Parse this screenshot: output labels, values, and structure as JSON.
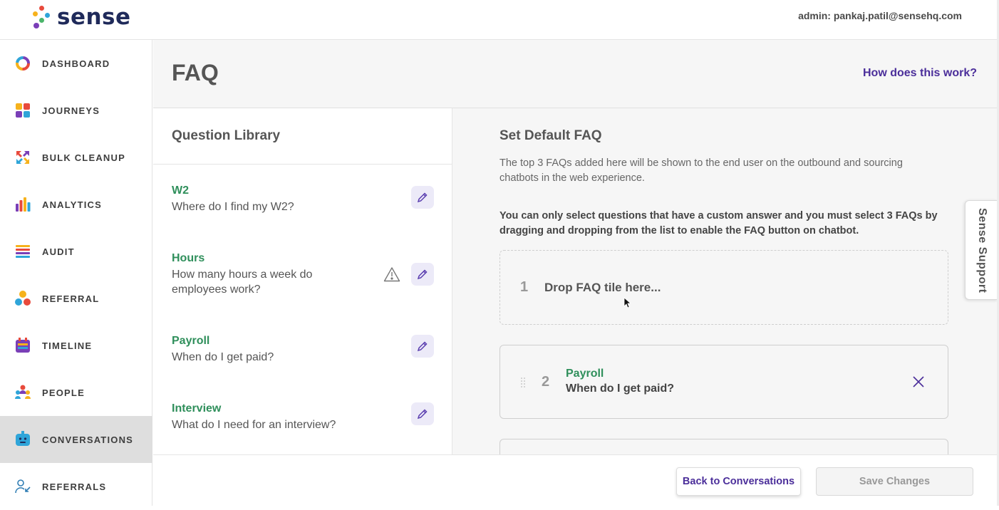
{
  "brand": {
    "name": "sense"
  },
  "topbar": {
    "admin_label": "admin: pankaj.patil@sensehq.com"
  },
  "sidebar": {
    "items": [
      {
        "label": "DASHBOARD",
        "icon": "dashboard-icon"
      },
      {
        "label": "JOURNEYS",
        "icon": "journeys-icon"
      },
      {
        "label": "BULK CLEANUP",
        "icon": "bulk-cleanup-icon"
      },
      {
        "label": "ANALYTICS",
        "icon": "analytics-icon"
      },
      {
        "label": "AUDIT",
        "icon": "audit-icon"
      },
      {
        "label": "REFERRAL",
        "icon": "referral-icon"
      },
      {
        "label": "TIMELINE",
        "icon": "timeline-icon"
      },
      {
        "label": "PEOPLE",
        "icon": "people-icon"
      },
      {
        "label": "CONVERSATIONS",
        "icon": "conversations-icon",
        "active": true
      },
      {
        "label": "REFERRALS",
        "icon": "referrals-icon"
      }
    ]
  },
  "header": {
    "title": "FAQ",
    "help_link": "How does this work?"
  },
  "library": {
    "title": "Question Library",
    "questions": [
      {
        "name": "W2",
        "text": "Where do I find my W2?",
        "warning": false
      },
      {
        "name": "Hours",
        "text": "How many hours a week do employees work?",
        "warning": true
      },
      {
        "name": "Payroll",
        "text": "When do I get paid?",
        "warning": false
      },
      {
        "name": "Interview",
        "text": "What do I need for an interview?",
        "warning": false
      }
    ]
  },
  "default_faq": {
    "title": "Set Default FAQ",
    "description": "The top 3 FAQs added here will be shown to the end user on the outbound and sourcing chatbots in the web experience.",
    "note": "You can only select questions that have a custom answer and you must select 3 FAQs by dragging and dropping from the list to enable the FAQ button on chatbot.",
    "slot1": {
      "number": "1",
      "placeholder": "Drop FAQ tile here..."
    },
    "slot2": {
      "number": "2",
      "name": "Payroll",
      "text": "When do I get paid?"
    }
  },
  "footer": {
    "back_label": "Back to Conversations",
    "save_label": "Save Changes"
  },
  "support_tab": {
    "label": "Sense Support"
  },
  "colors": {
    "accent": "#4b2e9a",
    "question_name": "#2f8f5b",
    "active_nav_bg": "#dedede"
  }
}
